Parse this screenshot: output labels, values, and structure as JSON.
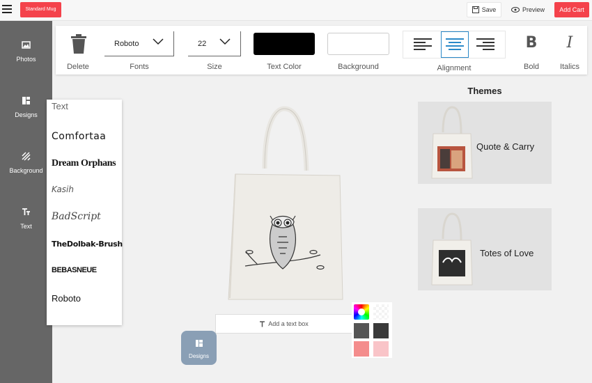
{
  "app": {
    "brand_label": "Standard Mug",
    "save_label": "Save",
    "preview_label": "Preview",
    "cart_label": "Add Cart"
  },
  "sidebar": {
    "items": [
      {
        "label": "Photos",
        "icon": "image-icon"
      },
      {
        "label": "Designs",
        "icon": "grid-icon"
      },
      {
        "label": "Background",
        "icon": "hatch-icon"
      },
      {
        "label": "Text",
        "icon": "text-size-icon"
      }
    ]
  },
  "toolbar": {
    "delete_label": "Delete",
    "fonts_label": "Fonts",
    "font_value": "Roboto",
    "size_label": "Size",
    "size_value": "22",
    "text_color_label": "Text Color",
    "text_color": "#000000",
    "background_label": "Background",
    "background_color": "#ffffff",
    "alignment_label": "Alignment",
    "alignment_selected": "center",
    "bold_label": "Bold",
    "bold_glyph": "B",
    "italics_label": "Italics",
    "italics_glyph": "I"
  },
  "font_panel": {
    "header": "Text",
    "options": [
      "Comfortaa",
      "Dream Orphans",
      "Kasih",
      "BadScript",
      "TheDolbak-Brush",
      "BEBASNEUE",
      "Roboto"
    ]
  },
  "canvas": {
    "text_box_label": "Add a text box",
    "designs_fab_label": "Designs"
  },
  "palette": {
    "colors": [
      "rainbow",
      "transparent",
      "#555555",
      "#3a3a3a",
      "#f48c8c",
      "#f9c4c8"
    ]
  },
  "themes": {
    "title": "Themes",
    "cards": [
      {
        "label": "Quote & Carry"
      },
      {
        "label": "Totes of Love"
      }
    ]
  },
  "colors": {
    "accent": "#f4424b",
    "sidebar": "#666666",
    "active_align": "#2a89c8",
    "fab": "#8a9fb5"
  }
}
